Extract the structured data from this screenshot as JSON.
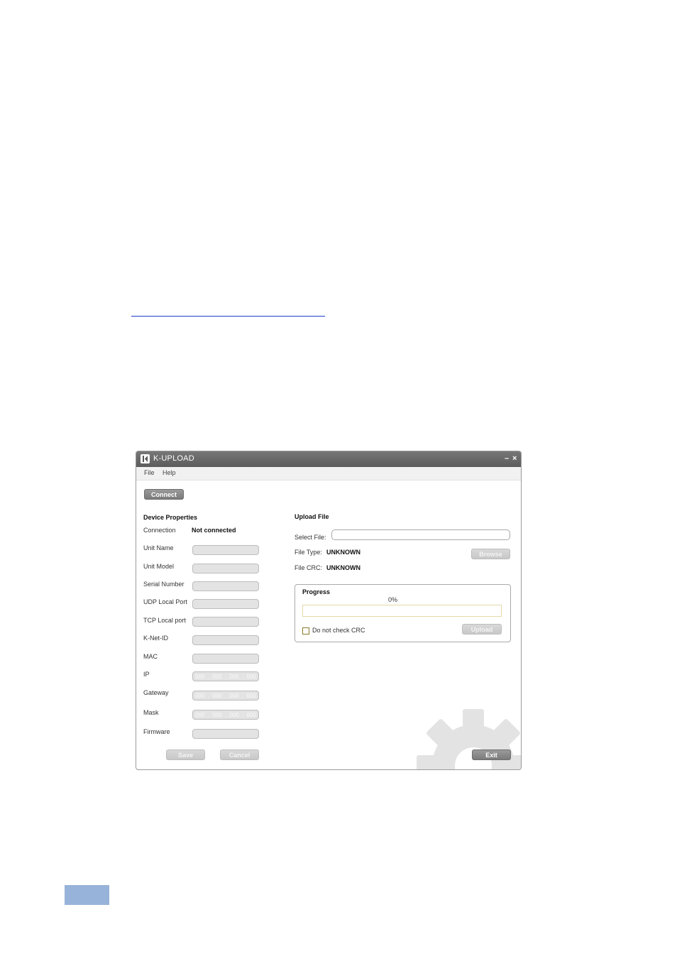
{
  "window": {
    "title": "K-UPLOAD",
    "minimize": "–",
    "close": "×"
  },
  "menu": {
    "file": "File",
    "help": "Help"
  },
  "connect_button": "Connect",
  "device_properties": {
    "heading": "Device Properties",
    "connection_label": "Connection",
    "connection_value": "Not connected",
    "fields": {
      "unit_name": "Unit Name",
      "unit_model": "Unit Model",
      "serial_number": "Serial Number",
      "udp_local_port": "UDP Local Port",
      "tcp_local_port": "TCP Local port",
      "k_net_id": "K-Net-ID",
      "mac": "MAC",
      "ip": "IP",
      "gateway": "Gateway",
      "mask": "Mask",
      "firmware": "Firmware"
    },
    "ip_octet": "000",
    "ip_dot": ".",
    "save_button": "Save",
    "cancel_button": "Cancel"
  },
  "upload": {
    "heading": "Upload File",
    "select_file_label": "Select File:",
    "select_file_value": "",
    "file_type_label": "File Type:",
    "file_type_value": "UNKNOWN",
    "file_crc_label": "File CRC:",
    "file_crc_value": "UNKNOWN",
    "browse_button": "Browse",
    "progress_heading": "Progress",
    "progress_percent_text": "0%",
    "progress_value": 0,
    "no_crc_label": "Do not check CRC",
    "no_crc_checked": false,
    "upload_button": "Upload"
  },
  "exit_button": "Exit",
  "colors": {
    "titlebar": "#666666",
    "page_tab": "#97b3d9",
    "link_underline": "#1a3ccc",
    "gear": "#e3e3e3"
  }
}
